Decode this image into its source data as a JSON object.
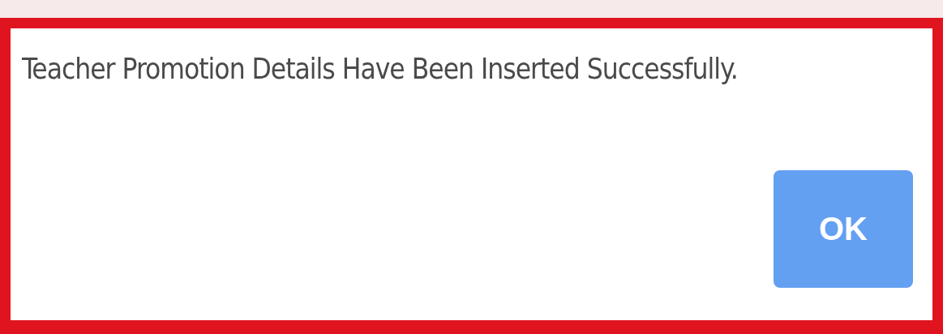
{
  "dialog": {
    "message": "Teacher Promotion Details Have Been Inserted Successfully.",
    "buttons": [
      "OK"
    ]
  }
}
